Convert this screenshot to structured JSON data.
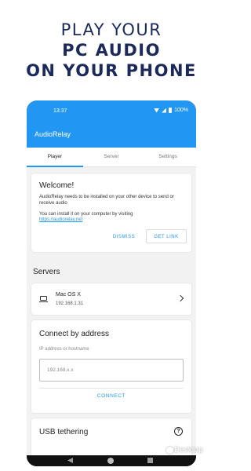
{
  "headline": {
    "line1": "PLAY YOUR",
    "line2": "PC AUDIO",
    "line3": "ON YOUR PHONE"
  },
  "statusbar": {
    "time": "13:37",
    "battery": "100%"
  },
  "app": {
    "title": "AudioRelay",
    "accent_color": "#2196f3"
  },
  "tabs": [
    {
      "label": "Player",
      "active": true
    },
    {
      "label": "Server",
      "active": false
    },
    {
      "label": "Settings",
      "active": false
    }
  ],
  "welcome": {
    "title": "Welcome!",
    "text1": "AudioRelay needs to be installed on your other device to send or receive audio",
    "text2": "You can install it on your computer by visiting",
    "link": "https://audiorelay.net",
    "dismiss_label": "DISMISS",
    "getlink_label": "GET LINK"
  },
  "servers": {
    "heading": "Servers",
    "items": [
      {
        "name": "Mac OS X",
        "ip": "192.168.1.31",
        "icon": "monitor-icon"
      }
    ]
  },
  "connect": {
    "title": "Connect by address",
    "label": "IP address or hostname",
    "placeholder": "192.168.x.x",
    "button_label": "CONNECT"
  },
  "usb": {
    "title": "USB tethering",
    "icon": "help-icon"
  },
  "watermark": {
    "text": "Desktop"
  }
}
